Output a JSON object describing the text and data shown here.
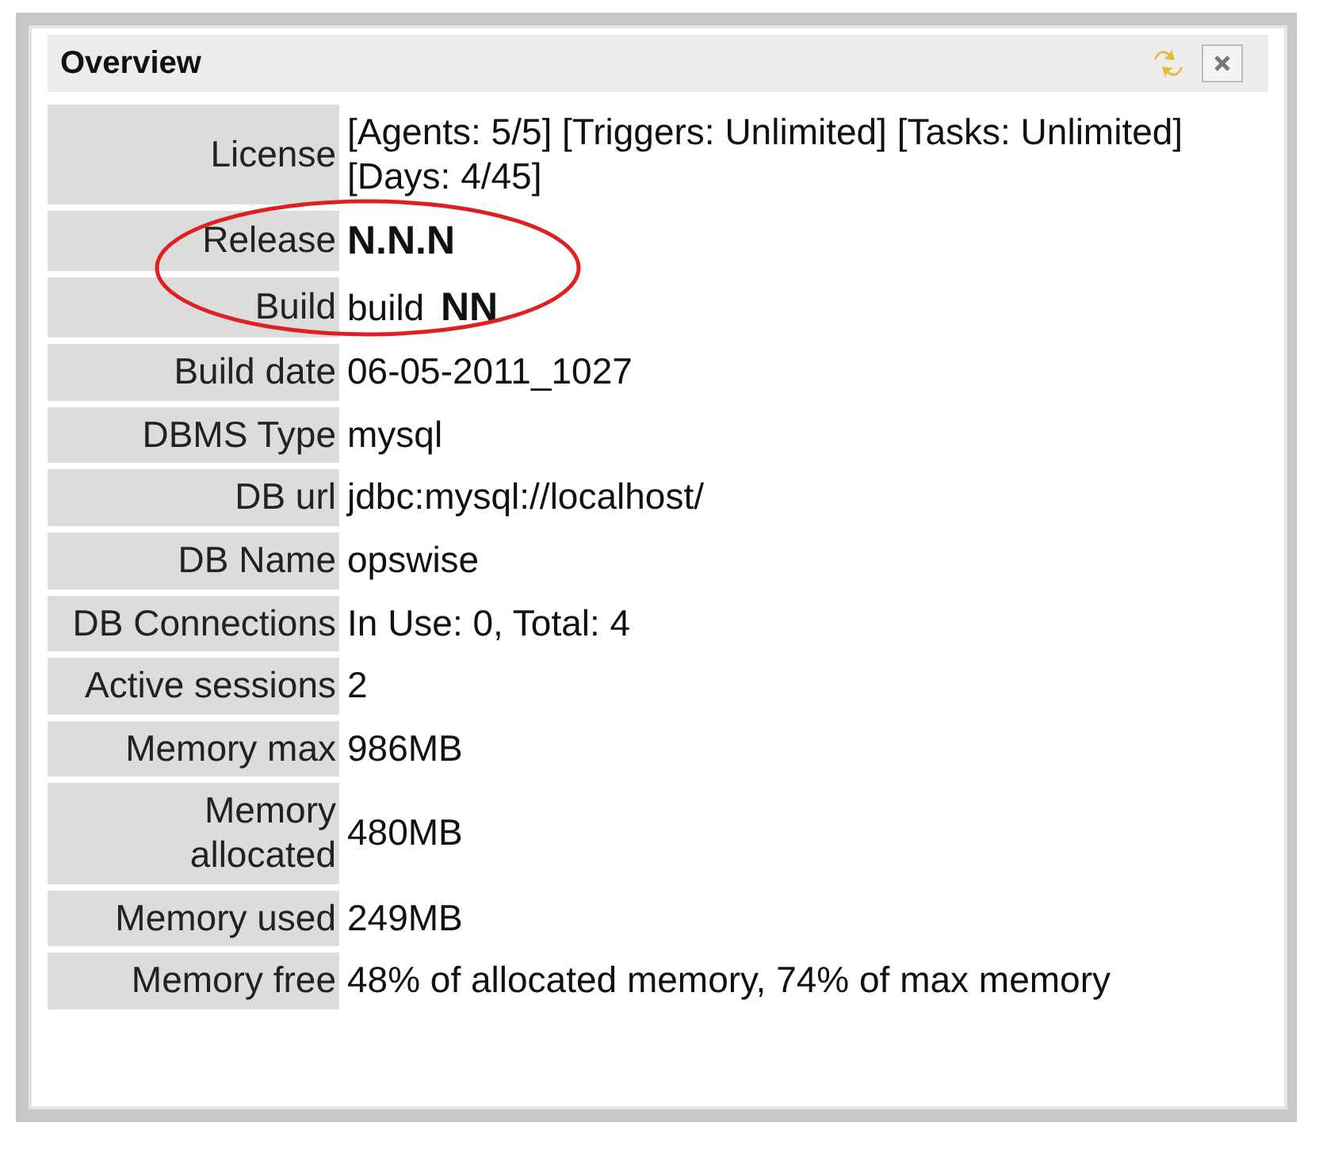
{
  "panel": {
    "title": "Overview"
  },
  "annotation": {
    "kind": "ellipse"
  },
  "rows": [
    {
      "label": "License",
      "value": "[Agents: 5/5] [Triggers: Unlimited] [Tasks: Unlimited] [Days: 4/45]",
      "kind": "plain"
    },
    {
      "label": "Release",
      "value": "N.N.N",
      "kind": "bold"
    },
    {
      "label": "Build",
      "value": "build **NN**",
      "kind": "marked"
    },
    {
      "label": "Build date",
      "value": "06-05-2011_1027",
      "kind": "plain"
    },
    {
      "label": "DBMS Type",
      "value": "mysql",
      "kind": "plain"
    },
    {
      "label": "DB url",
      "value": "jdbc:mysql://localhost/",
      "kind": "plain"
    },
    {
      "label": "DB Name",
      "value": "opswise",
      "kind": "plain"
    },
    {
      "label": "DB Connections",
      "value": "In Use: 0, Total: 4",
      "kind": "plain"
    },
    {
      "label": "Active sessions",
      "value": "2",
      "kind": "plain"
    },
    {
      "label": "Memory max",
      "value": "986MB",
      "kind": "plain"
    },
    {
      "label": "Memory allocated",
      "value": "480MB",
      "kind": "plain"
    },
    {
      "label": "Memory used",
      "value": "249MB",
      "kind": "plain"
    },
    {
      "label": "Memory free",
      "value": "48% of allocated memory, 74% of max memory",
      "kind": "plain"
    }
  ]
}
